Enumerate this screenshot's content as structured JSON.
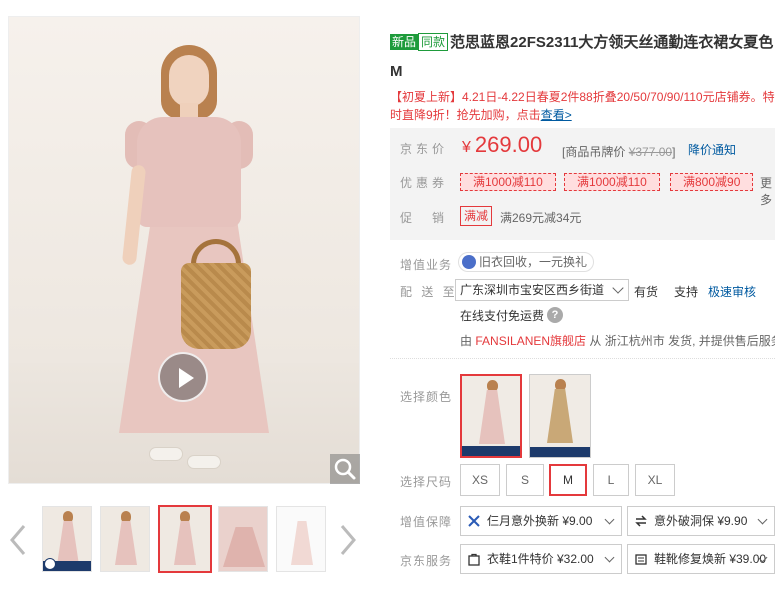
{
  "gallery": {
    "zoom_icon": "magnifier-icon",
    "play_icon": "play-icon",
    "thumb_count": 5,
    "active_thumb": 3
  },
  "product": {
    "tag_new": "新品",
    "tag_same": "同款",
    "title": "范思蓝恩22FS2311大方领天丝通勤连衣裙女夏色 M"
  },
  "promo": {
    "line1": "【初夏上新】4.21日-4.22日春夏2件88折叠20/50/70/90/110元店铺券。特",
    "line2_prefix": "时直降9折！抢先加购，点击",
    "line2_link": "查看>"
  },
  "price": {
    "label": "京东价",
    "currency": "¥",
    "value": "269.00",
    "ref_prefix": "[商品吊牌价",
    "ref_value": "¥377.00",
    "ref_suffix": "]",
    "notify": "降价通知"
  },
  "coupons": {
    "label": "优惠券",
    "items": [
      "满1000减110",
      "满1000减110",
      "满800减90"
    ],
    "more": "更多"
  },
  "sale": {
    "label": "促　销",
    "tag": "满减",
    "text": "满269元减34元"
  },
  "value_service": {
    "label": "增值业务",
    "recycle": "旧衣回收，一元换礼"
  },
  "delivery": {
    "label": "配 送 至",
    "address": "广东深圳市宝安区西乡街道",
    "stock": "有货",
    "support": "支持",
    "support_link": "极速审核",
    "free_ship": "在线支付免运费",
    "ship_from_prefix": "由",
    "shop": "FANSILANEN旗舰店",
    "ship_from_suffix": "从 浙江杭州市 发货, 并提供售后服务"
  },
  "color": {
    "label": "选择颜色",
    "options": [
      "粉色",
      "卡其色"
    ],
    "selected": 0
  },
  "sizes": {
    "label": "选择尺码",
    "options": [
      "XS",
      "S",
      "M",
      "L",
      "XL"
    ],
    "selected": "M"
  },
  "guarantee": {
    "label": "增值保障",
    "items": [
      "仨月意外换新 ¥9.00",
      "意外破洞保 ¥9.90"
    ]
  },
  "jd_service": {
    "label": "京东服务",
    "items": [
      "衣鞋1件特价 ¥32.00",
      "鞋靴修复焕新 ¥39.00"
    ]
  },
  "colors": {
    "accent": "#e4393c",
    "link": "#005aa0",
    "new_tag": "#1e9b3b"
  }
}
